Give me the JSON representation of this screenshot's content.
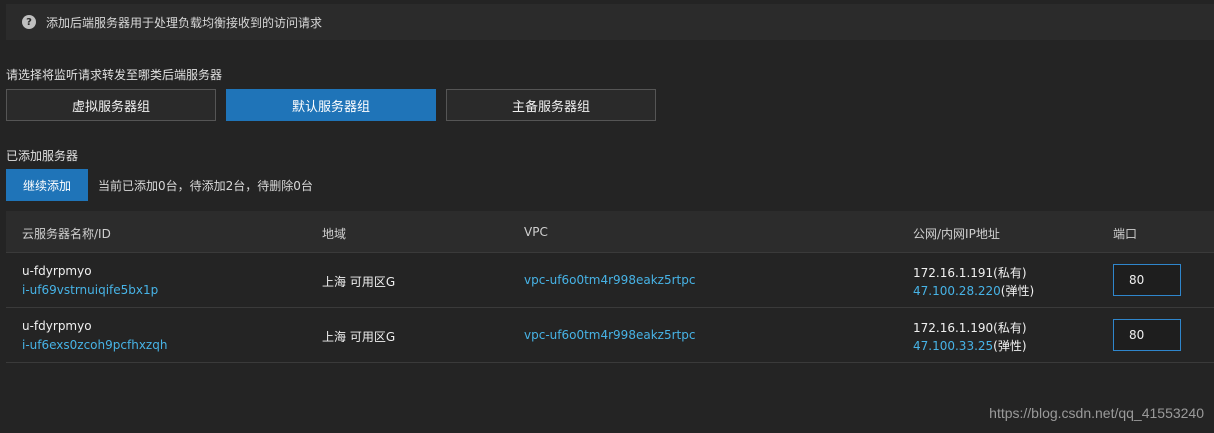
{
  "notice": {
    "icon": "question-circle-icon",
    "text": "添加后端服务器用于处理负载均衡接收到的访问请求"
  },
  "group_select": {
    "label": "请选择将监听请求转发至哪类后端服务器",
    "options": [
      "虚拟服务器组",
      "默认服务器组",
      "主备服务器组"
    ],
    "selected": "默认服务器组"
  },
  "added": {
    "label": "已添加服务器",
    "add_button": "继续添加",
    "status": "当前已添加0台，待添加2台，待删除0台"
  },
  "table": {
    "headers": [
      "云服务器名称/ID",
      "地域",
      "VPC",
      "公网/内网IP地址",
      "端口"
    ],
    "rows": [
      {
        "name": "u-fdyrpmyo",
        "id": "i-uf69vstrnuiqife5bx1p",
        "region": "上海 可用区G",
        "vpc": "vpc-uf6o0tm4r998eakz5rtpc",
        "private_ip": "172.16.1.191",
        "private_tag": "(私有)",
        "public_ip": "47.100.28.220",
        "public_tag": "(弹性)",
        "port": "80"
      },
      {
        "name": "u-fdyrpmyo",
        "id": "i-uf6exs0zcoh9pcfhxzqh",
        "region": "上海 可用区G",
        "vpc": "vpc-uf6o0tm4r998eakz5rtpc",
        "private_ip": "172.16.1.190",
        "private_tag": "(私有)",
        "public_ip": "47.100.33.25",
        "public_tag": "(弹性)",
        "port": "80"
      }
    ]
  },
  "watermark": "https://blog.csdn.net/qq_41553240",
  "colors": {
    "accent": "#1f74b8",
    "link": "#47b3e6",
    "background": "#242424"
  }
}
